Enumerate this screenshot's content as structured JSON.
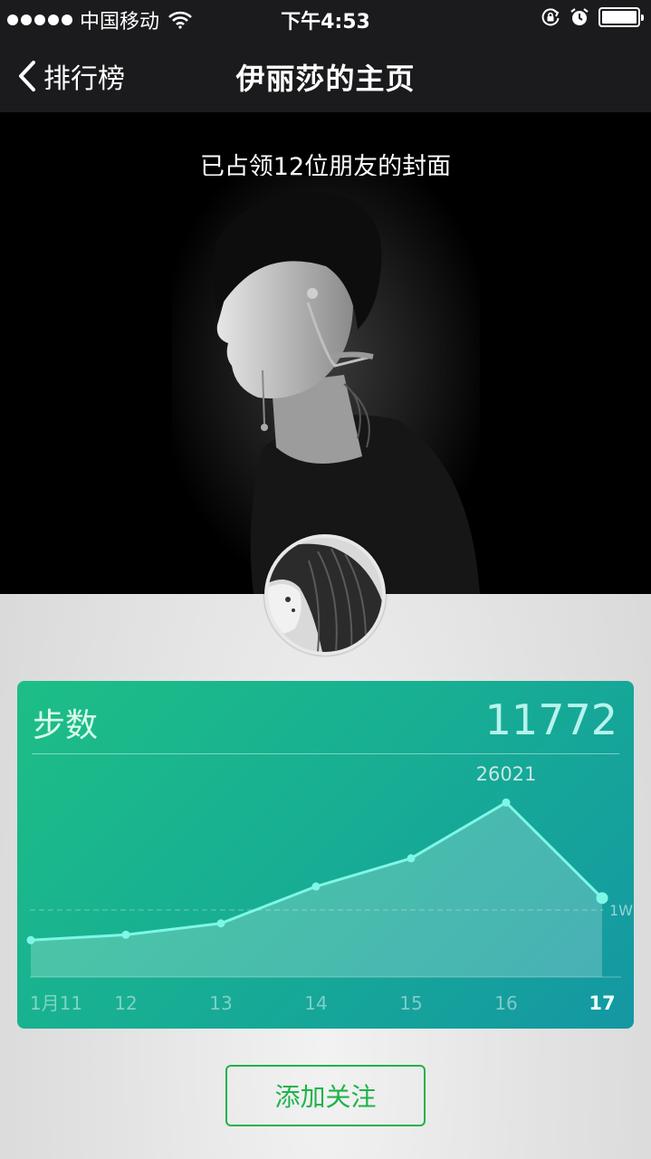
{
  "status_bar": {
    "carrier": "中国移动",
    "time": "下午4:53",
    "battery_level": 1.0
  },
  "nav": {
    "back_label": "排行榜",
    "title": "伊丽莎的主页"
  },
  "cover": {
    "caption": "已占领12位朋友的封面"
  },
  "steps": {
    "label": "步数",
    "value": "11772",
    "colors": {
      "accent": "#7ef7e6",
      "gradient_start": "#1dbe86",
      "gradient_end": "#1497a3"
    }
  },
  "chart_data": {
    "type": "area",
    "categories": [
      "1月11",
      "12",
      "13",
      "14",
      "15",
      "16",
      "17"
    ],
    "values": [
      5500,
      6300,
      8000,
      13500,
      17700,
      26021,
      11772
    ],
    "ylim": [
      0,
      32000
    ],
    "reference_line": {
      "value": 10000,
      "label": "1W"
    },
    "annotations": [
      {
        "category": "16",
        "text": "26021"
      }
    ],
    "highlight_category": "17",
    "grid": false
  },
  "actions": {
    "follow_label": "添加关注"
  }
}
